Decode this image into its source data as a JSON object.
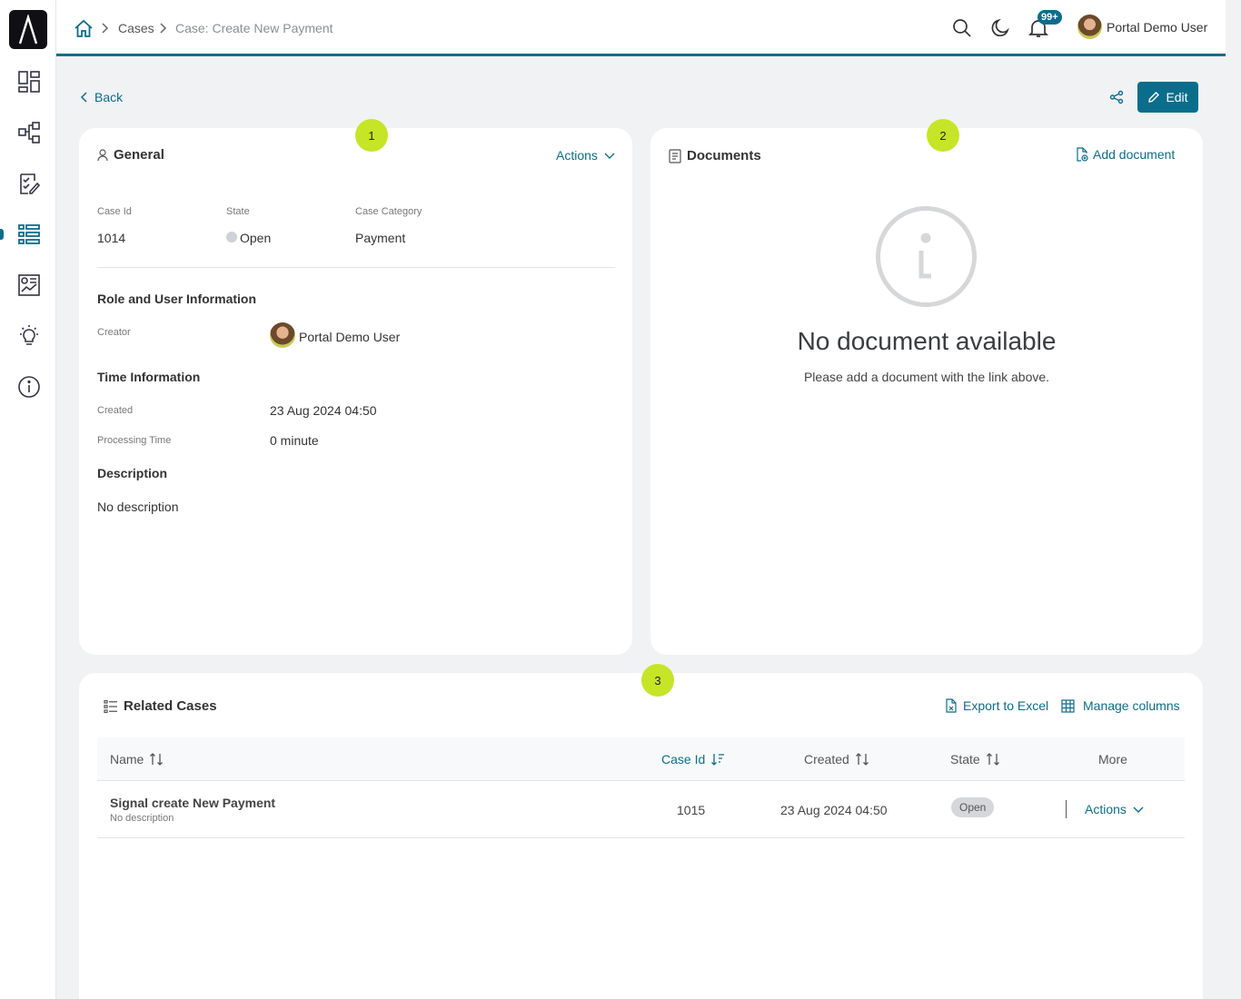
{
  "sidebar": {
    "items": [
      "dashboard-icon",
      "process-icon",
      "tasks-icon",
      "cases-icon",
      "statistics-icon",
      "ideas-icon",
      "info-icon"
    ]
  },
  "breadcrumb": {
    "home": "home-icon",
    "items": [
      "Cases",
      "Case: Create New Payment"
    ]
  },
  "header": {
    "notification_count": "99+",
    "user_name": "Portal Demo User"
  },
  "toolbar": {
    "back_label": "Back",
    "edit_label": "Edit"
  },
  "general": {
    "step": "1",
    "title": "General",
    "actions_label": "Actions",
    "case_id_label": "Case Id",
    "case_id": "1014",
    "state_label": "State",
    "state": "Open",
    "category_label": "Case Category",
    "category": "Payment",
    "role_heading": "Role and User Information",
    "creator_label": "Creator",
    "creator": "Portal Demo User",
    "time_heading": "Time Information",
    "created_label": "Created",
    "created": "23 Aug 2024 04:50",
    "processing_label": "Processing Time",
    "processing": "0 minute",
    "description_heading": "Description",
    "description": "No description"
  },
  "documents": {
    "step": "2",
    "title": "Documents",
    "add_label": "Add document",
    "empty_title": "No document available",
    "empty_hint": "Please add a document with the link above."
  },
  "related": {
    "step": "3",
    "title": "Related Cases",
    "export_label": "Export to Excel",
    "manage_label": "Manage columns",
    "columns": [
      "Name",
      "Case Id",
      "Created",
      "State",
      "More"
    ],
    "rows": [
      {
        "name": "Signal create New Payment",
        "description": "No description",
        "case_id": "1015",
        "created": "23 Aug 2024 04:50",
        "state": "Open",
        "actions": "Actions"
      }
    ]
  },
  "colors": {
    "accent": "#0b6d8c",
    "step_marker": "#c6e526",
    "background": "#f1f2f4"
  }
}
